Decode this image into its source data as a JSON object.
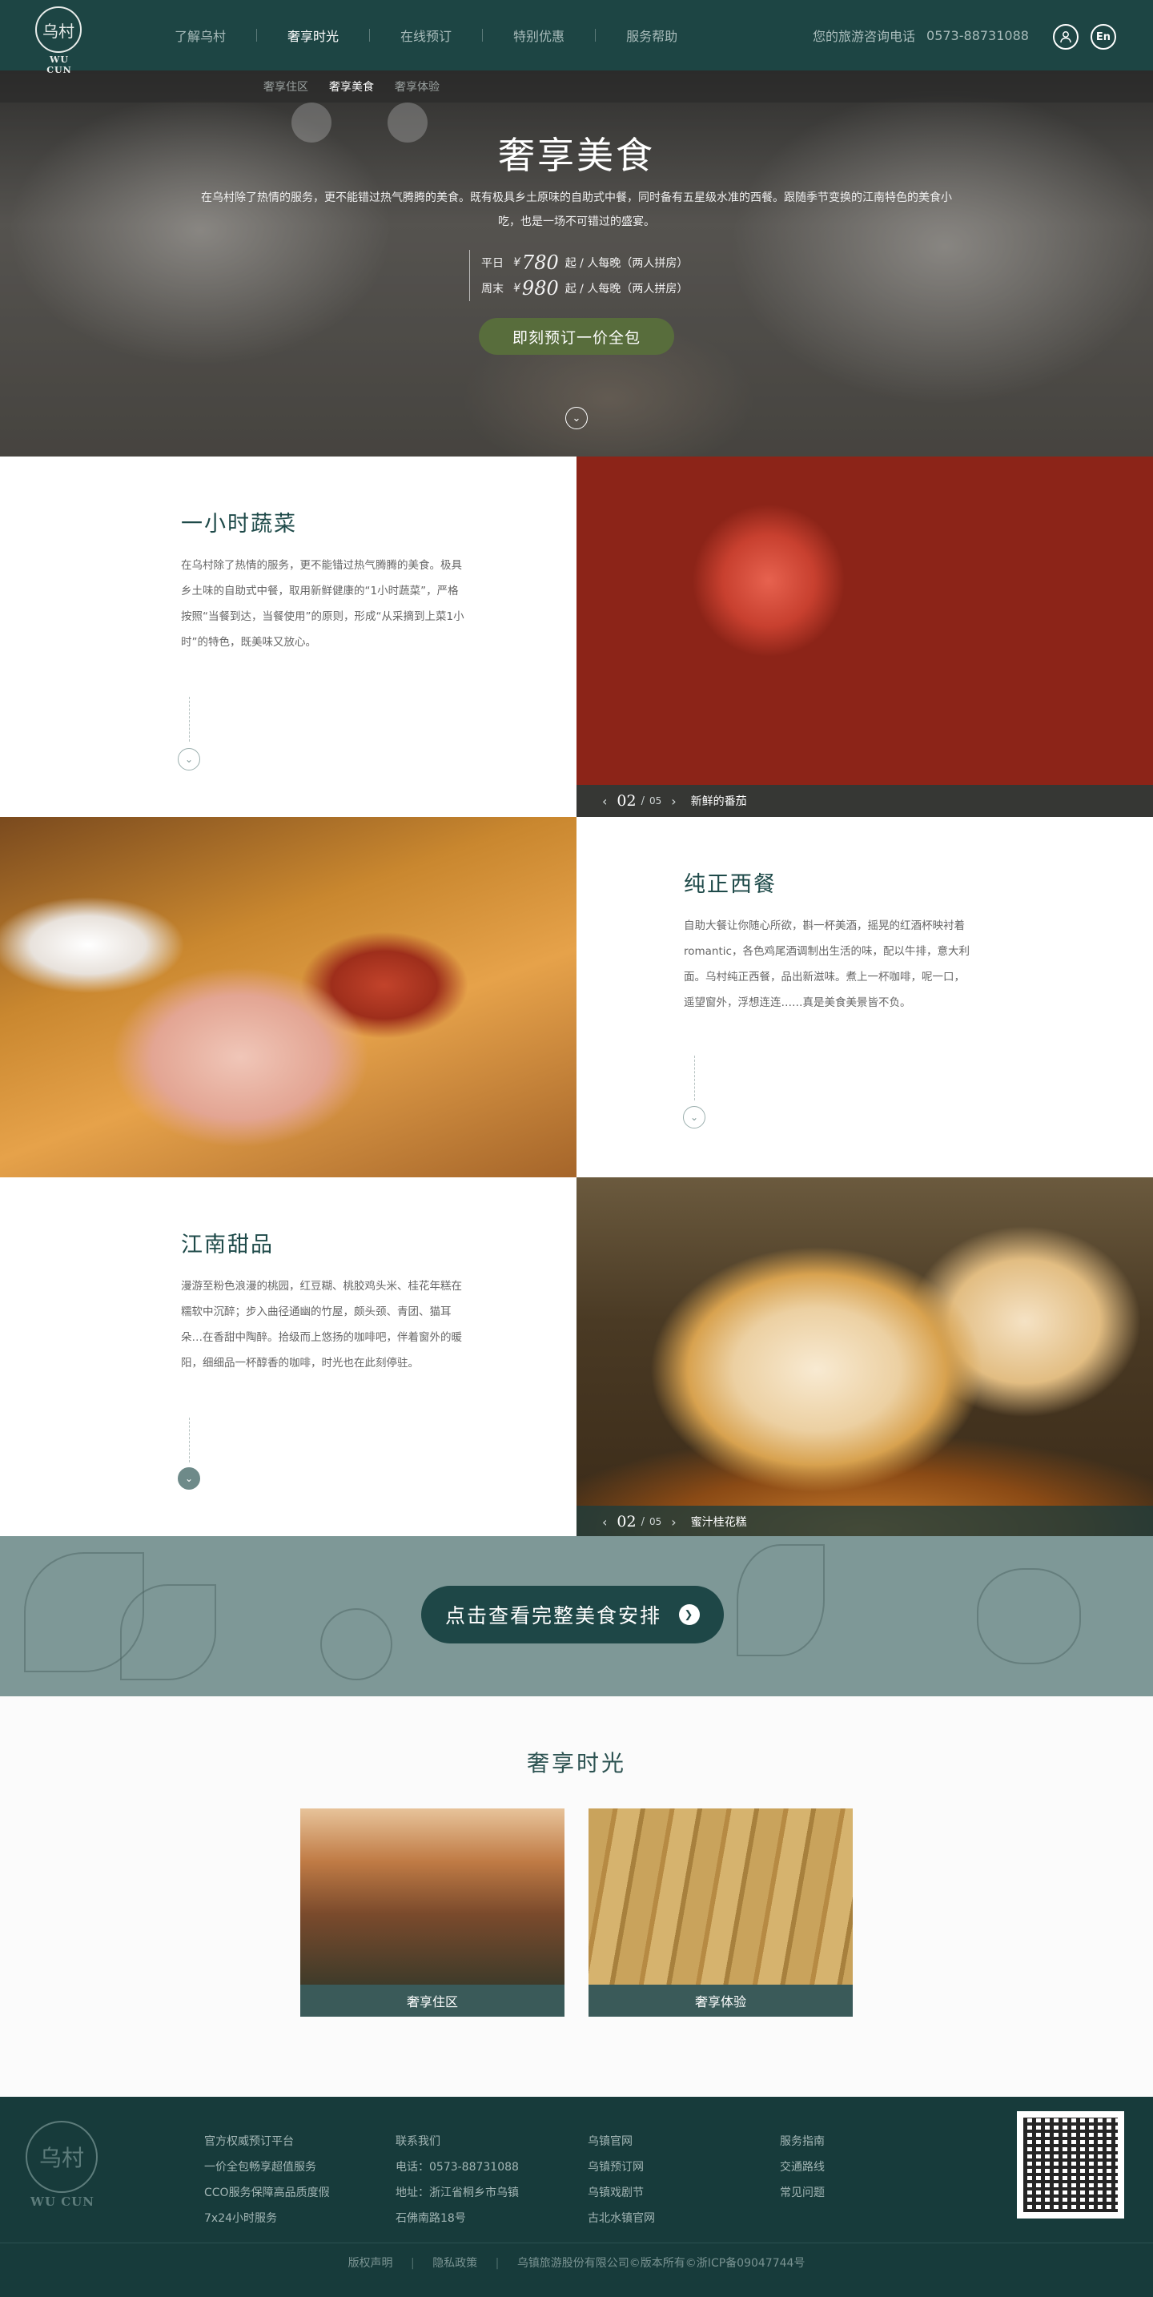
{
  "header": {
    "logo_text": "乌村",
    "logo_wordmark": "WU CUN",
    "nav": [
      {
        "label": "了解乌村"
      },
      {
        "label": "奢享时光"
      },
      {
        "label": "在线预订"
      },
      {
        "label": "特别优惠"
      },
      {
        "label": "服务帮助"
      }
    ],
    "active_nav": "奢享时光",
    "hotline_label": "您的旅游咨询电话",
    "hotline_number": "0573-88731088",
    "lang_label": "En",
    "user_icon": "user-icon"
  },
  "subnav": [
    {
      "label": "奢享住区"
    },
    {
      "label": "奢享美食"
    },
    {
      "label": "奢享体验"
    }
  ],
  "hero": {
    "title": "奢享美食",
    "desc": "在乌村除了热情的服务，更不能错过热气腾腾的美食。既有极具乡土原味的自助式中餐，同时备有五星级水准的西餐。跟随季节变换的江南特色的美食小吃，也是一场不可错过的盛宴。",
    "prices": [
      {
        "label": "平日",
        "currency": "¥",
        "amount": "780",
        "suffix": "起 / 人每晚（两人拼房）"
      },
      {
        "label": "周末",
        "currency": "¥",
        "amount": "980",
        "suffix": "起 / 人每晚（两人拼房）"
      }
    ],
    "book_button": "即刻预订一价全包",
    "scroll_icon": "chevron-down-icon"
  },
  "sections": [
    {
      "title": "一小时蔬菜",
      "text": "在乌村除了热情的服务，更不能错过热气腾腾的美食。极具乡土味的自助式中餐，取用新鲜健康的“1小时蔬菜”，严格按照“当餐到达，当餐使用”的原则，形成“从采摘到上菜1小时”的特色，既美味又放心。",
      "caption": {
        "current": "02",
        "total": "05",
        "name": "新鲜的番茄"
      }
    },
    {
      "title": "纯正西餐",
      "text": "自助大餐让你随心所欲，斟一杯美酒，摇晃的红酒杯映衬着romantic，各色鸡尾酒调制出生活的味，配以牛排，意大利面。乌村纯正西餐，品出新滋味。煮上一杯咖啡，呢一口，遥望窗外，浮想连连……真是美食美景皆不负。"
    },
    {
      "title": "江南甜品",
      "text": "漫游至粉色浪漫的桃园，红豆糊、桃胶鸡头米、桂花年糕在糯软中沉醉；步入曲径通幽的竹屋，颇头颈、青团、猫耳朵…在香甜中陶醉。拾级而上悠扬的咖啡吧，伴着窗外的暖阳，细细品一杯醇香的咖啡，时光也在此刻停驻。",
      "caption": {
        "current": "02",
        "total": "05",
        "name": "蜜汁桂花糕"
      }
    }
  ],
  "banner": {
    "button": "点击查看完整美食安排"
  },
  "luxury": {
    "title": "奢享时光",
    "cards": [
      {
        "label": "奢享住区"
      },
      {
        "label": "奢享体验"
      }
    ]
  },
  "footer": {
    "logo_text": "乌村",
    "logo_wordmark": "WU CUN",
    "col1": [
      "官方权威预订平台",
      "一价全包畅享超值服务",
      "CCO服务保障高品质度假",
      "7x24小时服务"
    ],
    "col2": [
      "联系我们",
      "电话：0573-88731088",
      "地址：浙江省桐乡市乌镇",
      "石佛南路18号"
    ],
    "col3": [
      "乌镇官网",
      "乌镇预订网",
      "乌镇戏剧节",
      "古北水镇官网"
    ],
    "col4": [
      "服务指南",
      "交通路线",
      "常见问题"
    ],
    "links": [
      "版权声明",
      "隐私政策",
      "乌镇旅游股份有限公司©版本所有©浙ICP备09047744号"
    ]
  },
  "colors": {
    "header_bg": "#1d4544",
    "accent_green": "#586d3c",
    "title_teal": "#1e4a49",
    "banner_bg": "#7e9897",
    "footer_bg": "#173b3b"
  }
}
